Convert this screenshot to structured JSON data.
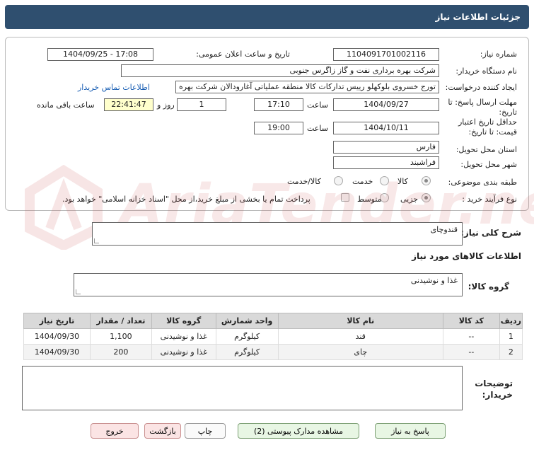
{
  "header": {
    "title": "جزئیات اطلاعات نیاز"
  },
  "form": {
    "need_number_label": "شماره نیاز:",
    "need_number": "1104091701002116",
    "announce_label": "تاریخ و ساعت اعلان عمومی:",
    "announce_value": "1404/09/25 - 17:08",
    "buyer_label": "نام دستگاه خریدار:",
    "buyer_value": "شرکت بهره برداری نفت و گاز زاگرس جنوبی",
    "creator_label": "ایجاد کننده درخواست:",
    "creator_value": "تورج خسروی بلوکهلو رییس تدارکات کالا منطقه عملیاتی آغارودالان شرکت بهره ب",
    "contact_link": "اطلاعات تماس خریدار",
    "deadline_label_1": "مهلت ارسال پاسخ: تا",
    "deadline_label_2": "تاریخ:",
    "deadline_date": "1404/09/27",
    "time_label": "ساعت",
    "deadline_time": "17:10",
    "days_value": "1",
    "days_label": "روز و",
    "remaining_time": "22:41:47",
    "remaining_label": "ساعت باقی مانده",
    "validity_label_1": "حداقل تاریخ اعتبار",
    "validity_label_2": "قیمت: تا تاریخ:",
    "validity_date": "1404/10/11",
    "validity_time": "19:00",
    "province_label": "استان محل تحویل:",
    "province_value": "فارس",
    "city_label": "شهر محل تحویل:",
    "city_value": "فراشبند",
    "category_label": "طبقه بندی موضوعی:",
    "category_options": [
      "کالا",
      "خدمت",
      "کالا/خدمت"
    ],
    "process_label": "نوع فرآیند خرید :",
    "process_options": [
      "جزیی",
      "متوسط"
    ],
    "payment_note": "پرداخت تمام یا بخشی از مبلغ خرید،از محل \"اسناد خزانه اسلامی\" خواهد بود."
  },
  "need_summary": {
    "label": "شرح کلی نیاز:",
    "value": "قندوچای"
  },
  "goods_section": {
    "title": "اطلاعات کالاهای مورد نیاز"
  },
  "goods_group": {
    "label": "گروه کالا:",
    "value": "غذا و نوشیدنی"
  },
  "table": {
    "headers": [
      "ردیف",
      "کد کالا",
      "نام کالا",
      "واحد شمارش",
      "گروه کالا",
      "تعداد / مقدار",
      "تاریخ نیاز"
    ],
    "rows": [
      [
        "1",
        "--",
        "قند",
        "کیلوگرم",
        "غذا و نوشیدنی",
        "1,100",
        "1404/09/30"
      ],
      [
        "2",
        "--",
        "چای",
        "کیلوگرم",
        "غذا و نوشیدنی",
        "200",
        "1404/09/30"
      ]
    ]
  },
  "buyer_notes": {
    "label_1": "توضیحات",
    "label_2": "خریدار:",
    "value": ""
  },
  "watermark": {
    "text": "AriaTender.neT"
  },
  "buttons": {
    "reply": "پاسخ به نیاز",
    "attachments": "مشاهده مدارک پیوستی (2)",
    "print": "چاپ",
    "back": "بازگشت",
    "exit": "خروج"
  }
}
